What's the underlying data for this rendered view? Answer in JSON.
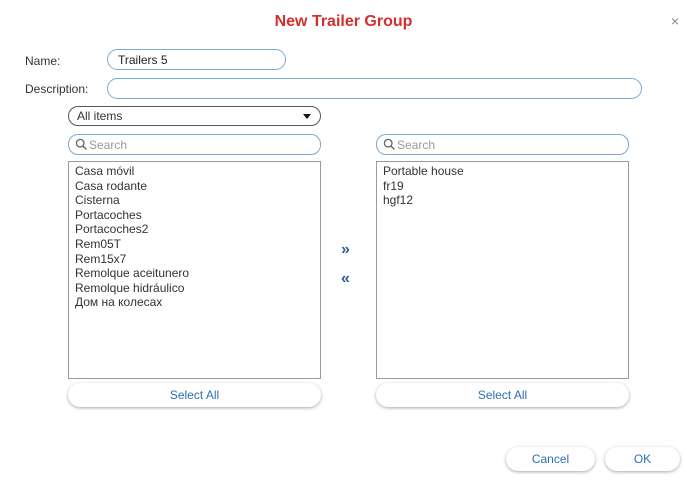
{
  "dialog": {
    "title": "New Trailer Group",
    "close_glyph": "×"
  },
  "form": {
    "name_label": "Name:",
    "name_value": "Trailers 5",
    "description_label": "Description:",
    "description_value": ""
  },
  "filter": {
    "selected": "All items"
  },
  "left_panel": {
    "search_placeholder": "Search",
    "items": [
      "Casa móvil",
      "Casa rodante",
      "Cisterna",
      "Portacoches",
      "Portacoches2",
      "Rem05T",
      "Rem15x7",
      "Remolque aceitunero",
      "Remolque hidráulico",
      "Дом на колесах"
    ],
    "select_all_label": "Select All"
  },
  "right_panel": {
    "search_placeholder": "Search",
    "items": [
      "Portable house",
      "fr19",
      "hgf12"
    ],
    "select_all_label": "Select All"
  },
  "transfer": {
    "add_glyph": "»",
    "remove_glyph": "«"
  },
  "footer": {
    "cancel_label": "Cancel",
    "ok_label": "OK"
  },
  "colors": {
    "title": "#d32f2f",
    "accent": "#2f6fb4",
    "field_border": "#7aa8d4"
  }
}
